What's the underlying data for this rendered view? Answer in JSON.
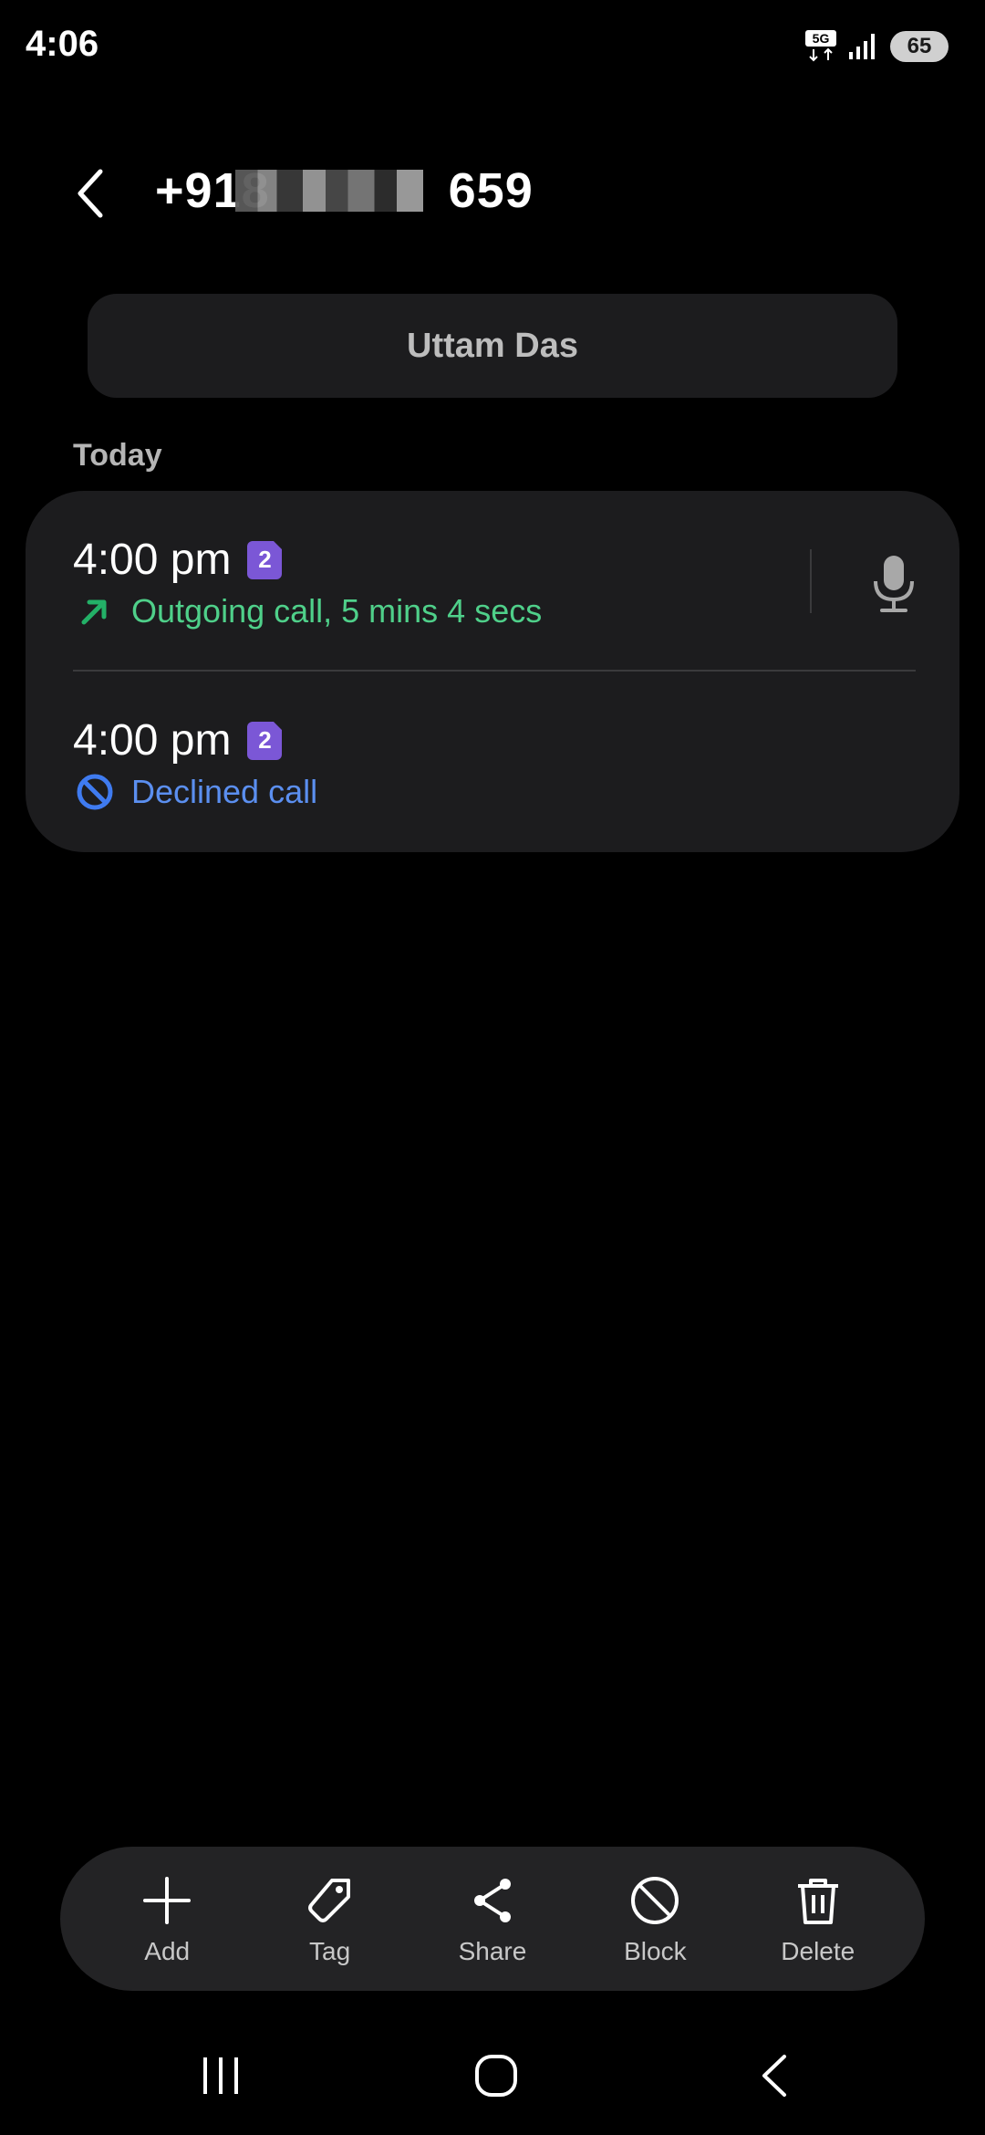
{
  "status_bar": {
    "time": "4:06",
    "network_label": "5G",
    "battery_level": "65"
  },
  "header": {
    "phone_number_prefix": "+918",
    "phone_number_suffix": "659",
    "back_icon": "chevron-left-icon"
  },
  "contact": {
    "name": "Uttam Das"
  },
  "call_log": {
    "section_label": "Today",
    "entries": [
      {
        "time": "4:00 pm",
        "sim": "2",
        "status": "Outgoing call, 5 mins 4 secs",
        "status_icon": "outgoing-arrow-icon",
        "status_color": "#4fd08a",
        "has_recording": true
      },
      {
        "time": "4:00 pm",
        "sim": "2",
        "status": "Declined call",
        "status_icon": "declined-icon",
        "status_color": "#5b8ff0",
        "has_recording": false
      }
    ]
  },
  "actions": [
    {
      "label": "Add",
      "icon": "plus-icon"
    },
    {
      "label": "Tag",
      "icon": "tag-icon"
    },
    {
      "label": "Share",
      "icon": "share-icon"
    },
    {
      "label": "Block",
      "icon": "block-icon"
    },
    {
      "label": "Delete",
      "icon": "trash-icon"
    }
  ],
  "nav_bar": {
    "recents_icon": "recents-icon",
    "home_icon": "home-icon",
    "back_icon": "back-icon"
  },
  "colors": {
    "background": "#000000",
    "card": "#1c1c1e",
    "sim_badge": "#7b57d6",
    "outgoing": "#4fd08a",
    "declined": "#5b8ff0"
  }
}
